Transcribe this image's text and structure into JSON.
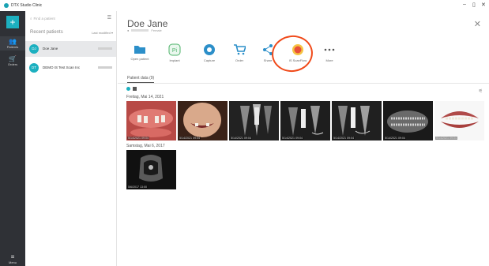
{
  "app": {
    "title": "DTX Studio Clinic"
  },
  "window_controls": {
    "minimize": "–",
    "maximize": "▯",
    "close": "✕"
  },
  "rail": {
    "add_label": "+",
    "items": [
      {
        "label": "Patients",
        "icon": "people-icon"
      },
      {
        "label": "Orders",
        "icon": "cart-icon"
      }
    ],
    "menu_label": "Menu"
  },
  "sidebar": {
    "search_placeholder": "Find a patient",
    "recent_title": "Recent patients",
    "sort_label": "Last modified ▾",
    "patients": [
      {
        "initials": "DJ",
        "name": "Doe Jane",
        "selected": true
      },
      {
        "initials": "DT",
        "name": "DEMO IS Test Scan Inc",
        "selected": false
      }
    ]
  },
  "patient": {
    "name": "Doe Jane",
    "sub": "Female"
  },
  "actions": [
    {
      "label": "Open patient",
      "icon": "folder-icon"
    },
    {
      "label": "Implant",
      "icon": "implant-icon"
    },
    {
      "label": "Capture",
      "icon": "aperture-icon"
    },
    {
      "label": "Order",
      "icon": "cart-icon"
    },
    {
      "label": "Share",
      "icon": "share-icon"
    },
    {
      "label": "IS ScanFlow",
      "icon": "scanflow-icon"
    },
    {
      "label": "More",
      "icon": "more-icon"
    }
  ],
  "tab": {
    "label": "Patient data (9)"
  },
  "groups": [
    {
      "date": "Freitag, Mai 14, 2021",
      "items": [
        {
          "caption": "5/14/2021 09:04",
          "kind": "photo-gums"
        },
        {
          "caption": "5/14/2021 09:04",
          "kind": "photo-smile"
        },
        {
          "caption": "5/14/2021 09:04",
          "kind": "xray"
        },
        {
          "caption": "5/14/2021 09:04",
          "kind": "xray"
        },
        {
          "caption": "5/14/2021 09:04",
          "kind": "xray"
        },
        {
          "caption": "5/14/2021 09:04",
          "kind": "pano"
        },
        {
          "caption": "5/14/2021 09:04",
          "kind": "model-3d"
        }
      ]
    },
    {
      "date": "Samstag, Mai 6, 2017",
      "items": [
        {
          "caption": "5/6/2017 13:00",
          "kind": "cbct"
        }
      ]
    }
  ],
  "colors": {
    "accent": "#1cb0c0",
    "rail": "#2f3136",
    "highlight": "#f04a1a"
  }
}
